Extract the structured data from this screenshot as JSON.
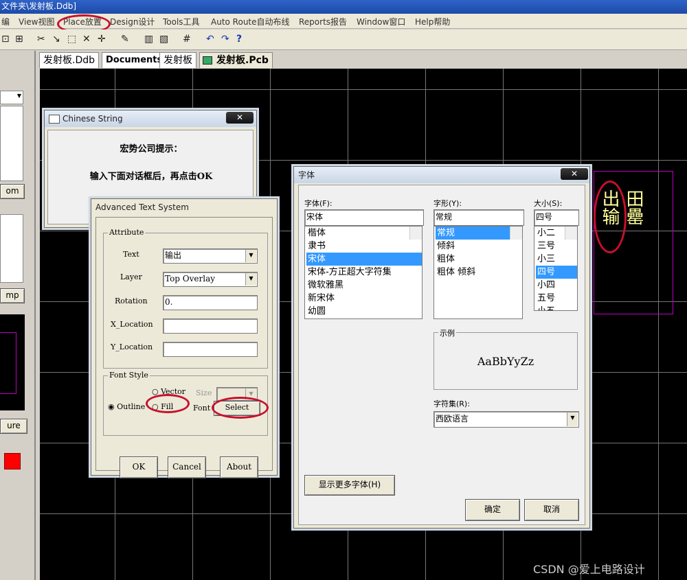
{
  "app": {
    "title": "文件夹\\发射板.Ddb]"
  },
  "menu": [
    "编",
    "View视图",
    "Place放置",
    "Design设计",
    "Tools工具",
    "Auto Route自动布线",
    "Reports报告",
    "Window窗口",
    "Help帮助"
  ],
  "tabs": [
    "发射板.Ddb",
    "Documents",
    "发射板",
    "发射板.Pcb"
  ],
  "left_panel": {
    "btn1": "om",
    "btn2": "mp",
    "btn3": "ure"
  },
  "chinese_string": {
    "title": "Chinese String",
    "close": "✕",
    "line1": "宏势公司提示：",
    "line2": "输入下面对话框后，再点击OK"
  },
  "ats": {
    "title": "Advanced Text System",
    "attribute_label": "Attribute",
    "text_label": "Text",
    "text_value": "输出",
    "layer_label": "Layer",
    "layer_value": "Top Overlay",
    "rotation_label": "Rotation",
    "rotation_value": "0.",
    "xloc_label": "X_Location",
    "xloc_value": "",
    "yloc_label": "Y_Location",
    "yloc_value": "",
    "font_style_label": "Font Style",
    "vector_label": "Vector",
    "size_label": "Size",
    "outline_label": "Outline",
    "fill_label": "Fill",
    "font_label": "Font",
    "select_label": "Select",
    "ok": "OK",
    "cancel": "Cancel",
    "about": "About"
  },
  "font_dialog": {
    "title": "字体",
    "close": "✕",
    "font_label": "字体(F):",
    "font_value": "宋体",
    "fonts": [
      "楷体",
      "隶书",
      "宋体",
      "宋体-方正超大字符集",
      "微软雅黑",
      "新宋体",
      "幼圆"
    ],
    "fonts_selected": 2,
    "style_label": "字形(Y):",
    "style_value": "常规",
    "styles": [
      "常规",
      "倾斜",
      "粗体",
      "粗体 倾斜"
    ],
    "styles_selected": 0,
    "size_label": "大小(S):",
    "size_value": "四号",
    "sizes": [
      "小二",
      "三号",
      "小三",
      "四号",
      "小四",
      "五号",
      "小五"
    ],
    "sizes_selected": 3,
    "sample_label": "示例",
    "sample_text": "AaBbYyZz",
    "charset_label": "字符集(R):",
    "charset_value": "西欧语言",
    "more_fonts": "显示更多字体(H)",
    "ok": "确定",
    "cancel": "取消"
  },
  "canvas_text": {
    "col1": "出输",
    "col2": "田罍"
  },
  "watermark": "CSDN @爱上电路设计",
  "colors": {
    "highlight": "#3399ff",
    "annotation": "#c8102e",
    "pcb_text": "#ffff99",
    "board_outline": "#c000c0"
  }
}
